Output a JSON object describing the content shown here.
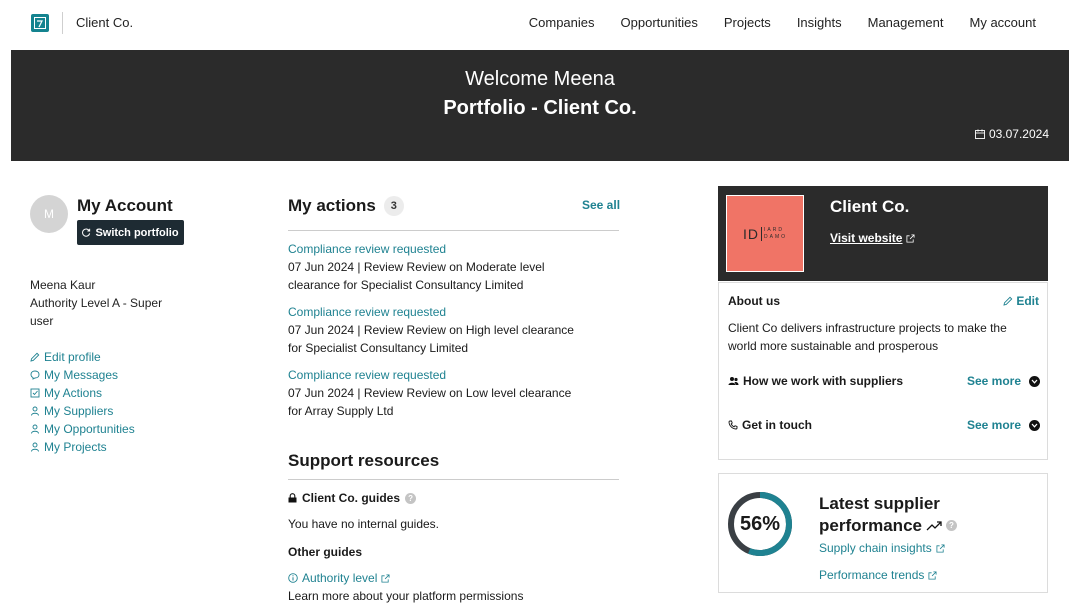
{
  "nav": {
    "brand": "Client Co.",
    "links": [
      "Companies",
      "Opportunities",
      "Projects",
      "Insights",
      "Management",
      "My account"
    ]
  },
  "hero": {
    "welcome": "Welcome Meena",
    "portfolio": "Portfolio - Client Co.",
    "date": "03.07.2024"
  },
  "account": {
    "avatar_initial": "M",
    "title": "My Account",
    "switch_label": "Switch portfolio",
    "user_name": "Meena Kaur",
    "user_role": "Authority Level A - Super user",
    "links": [
      "Edit profile",
      "My Messages",
      "My Actions",
      "My Suppliers",
      "My Opportunities",
      "My Projects"
    ]
  },
  "actions": {
    "title": "My actions",
    "count": "3",
    "see_all": "See all",
    "items": [
      {
        "title": "Compliance review requested",
        "detail": "07 Jun 2024 | Review Review on Moderate level clearance for Specialist Consultancy Limited"
      },
      {
        "title": "Compliance review requested",
        "detail": "07 Jun 2024 | Review Review on High level clearance for Specialist Consultancy Limited"
      },
      {
        "title": "Compliance review requested",
        "detail": "07 Jun 2024 | Review Review on Low level clearance for Array Supply Ltd"
      }
    ]
  },
  "support": {
    "title": "Support resources",
    "client_guides": "Client Co. guides",
    "no_guides": "You have no internal guides.",
    "other_guides": "Other guides",
    "authority_link": "Authority level",
    "learn_more": "Learn more about your platform permissions"
  },
  "company": {
    "name": "Client Co.",
    "visit": "Visit website",
    "logo_text": "ID",
    "logo_sub": [
      "I",
      "A",
      "R",
      "D",
      "D",
      "A",
      "M",
      "O"
    ]
  },
  "about": {
    "title": "About us",
    "edit": "Edit",
    "text": "Client Co delivers infrastructure projects to make the world more sustainable and prosperous",
    "how_we_work": "How we work with suppliers",
    "get_in_touch": "Get in touch",
    "see_more": "See more"
  },
  "performance": {
    "percent_label": "56%",
    "percent_value": 56,
    "title_line1": "Latest supplier",
    "title_line2": "performance",
    "link1": "Supply chain insights",
    "link2": "Performance trends",
    "colors": {
      "ring": "#1f8291",
      "track": "#3a3f44"
    }
  }
}
